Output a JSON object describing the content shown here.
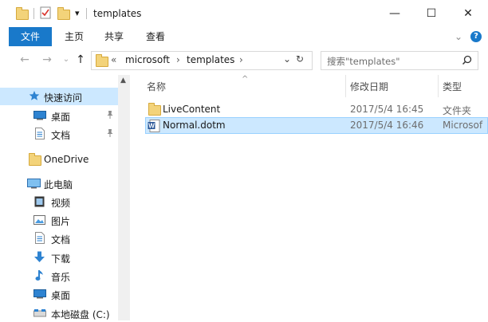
{
  "window": {
    "title": "templates",
    "qat_dropdown": "▾",
    "minimize": "—",
    "maximize": "☐",
    "close": "✕"
  },
  "ribbon": {
    "tabs": [
      "文件",
      "主页",
      "共享",
      "查看"
    ],
    "expand": "⌄",
    "help": "?"
  },
  "address": {
    "back": "←",
    "forward": "→",
    "history": "⌄",
    "up": "↑",
    "overflow": "«",
    "crumbs": [
      "microsoft",
      "templates"
    ],
    "crumb_sep": "›",
    "dropdown": "⌄",
    "refresh": "↻"
  },
  "search": {
    "placeholder": "搜索\"templates\""
  },
  "nav": {
    "items": [
      {
        "label": "快速访问",
        "icon": "star-icon"
      },
      {
        "label": "桌面",
        "icon": "desktop-icon",
        "pinned": true
      },
      {
        "label": "文档",
        "icon": "document-icon",
        "pinned": true
      },
      {
        "label": "OneDrive",
        "icon": "folder-icon"
      },
      {
        "label": "此电脑",
        "icon": "computer-icon"
      },
      {
        "label": "视频",
        "icon": "video-icon"
      },
      {
        "label": "图片",
        "icon": "picture-icon"
      },
      {
        "label": "文档",
        "icon": "document-icon"
      },
      {
        "label": "下载",
        "icon": "download-icon"
      },
      {
        "label": "音乐",
        "icon": "music-icon"
      },
      {
        "label": "桌面",
        "icon": "desktop-icon"
      },
      {
        "label": "本地磁盘 (C:)",
        "icon": "drive-icon"
      }
    ]
  },
  "columns": {
    "name": "名称",
    "modified": "修改日期",
    "type": "类型",
    "sort_indicator": "^"
  },
  "files": [
    {
      "name": "LiveContent",
      "modified": "2017/5/4 16:45",
      "type": "文件夹",
      "icon": "folder-icon"
    },
    {
      "name": "Normal.dotm",
      "modified": "2017/5/4 16:46",
      "type": "Microsof",
      "icon": "word-template-icon"
    }
  ],
  "colors": {
    "accent": "#1979ca",
    "selection": "#cce8ff",
    "folder": "#f3d37a"
  }
}
